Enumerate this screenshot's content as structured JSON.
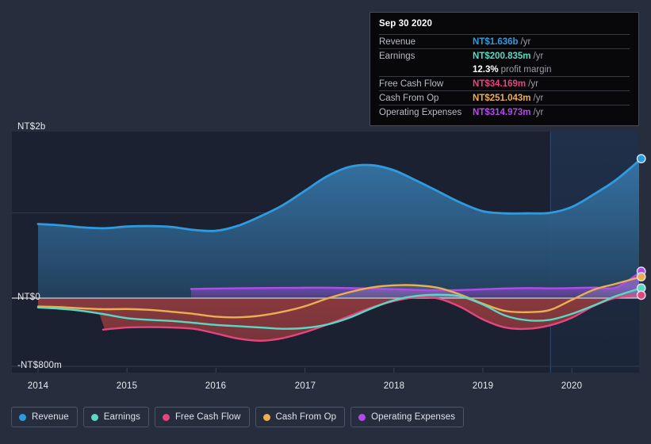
{
  "colors": {
    "background": "#262d3d",
    "plot_background": "#1b2130",
    "plot_background_future": "#1d273b",
    "revenue": "#2e9be0",
    "earnings": "#5ad8c4",
    "free_cash_flow": "#e5457e",
    "cash_from_op": "#edad52",
    "operating_expenses": "#b24be8",
    "negative_area": "#8e3a3e",
    "zero_line": "#c9ccd4",
    "grid_line": "#3b4356",
    "axis_text": "#e8eaee"
  },
  "tooltip": {
    "title": "Sep 30 2020",
    "rows": [
      {
        "name": "Revenue",
        "value": "NT$1.636b",
        "unit": "/yr",
        "color": "#2e9be0"
      },
      {
        "name": "Earnings",
        "value": "NT$200.835m",
        "unit": "/yr",
        "color": "#5ad8c4"
      },
      {
        "name": "",
        "value": "12.3%",
        "unit": "profit margin",
        "color": "#ffffff"
      },
      {
        "name": "Free Cash Flow",
        "value": "NT$34.169m",
        "unit": "/yr",
        "color": "#e5457e"
      },
      {
        "name": "Cash From Op",
        "value": "NT$251.043m",
        "unit": "/yr",
        "color": "#edad52"
      },
      {
        "name": "Operating Expenses",
        "value": "NT$314.973m",
        "unit": "/yr",
        "color": "#b24be8"
      }
    ]
  },
  "legend": {
    "items": [
      {
        "label": "Revenue",
        "color": "#2e9be0"
      },
      {
        "label": "Earnings",
        "color": "#5ad8c4"
      },
      {
        "label": "Free Cash Flow",
        "color": "#e5457e"
      },
      {
        "label": "Cash From Op",
        "color": "#edad52"
      },
      {
        "label": "Operating Expenses",
        "color": "#b24be8"
      }
    ]
  },
  "chart_data": {
    "type": "area",
    "title": "",
    "xlabel": "",
    "ylabel": "",
    "grid": true,
    "legend_position": "bottom",
    "x_ticks": [
      "2014",
      "2015",
      "2016",
      "2017",
      "2018",
      "2019",
      "2020"
    ],
    "x_tick_values": [
      2014,
      2015,
      2016,
      2017,
      2018,
      2019,
      2020
    ],
    "y_ticks": [
      "NT$2b",
      "NT$0",
      "-NT$800m"
    ],
    "y_tick_values": [
      2000,
      0,
      -800
    ],
    "ylim": [
      -1000,
      2350
    ],
    "xlim": [
      2014.0,
      2020.78
    ],
    "y_unit": "NT$ millions",
    "currency": "NT$",
    "forecast_boundary_x": 2019.76,
    "series": [
      {
        "name": "Revenue",
        "color": "#2e9be0",
        "x": [
          2014.0,
          2014.25,
          2014.5,
          2014.75,
          2015.0,
          2015.25,
          2015.5,
          2015.75,
          2016.0,
          2016.25,
          2016.5,
          2016.75,
          2017.0,
          2017.25,
          2017.5,
          2017.75,
          2018.0,
          2018.25,
          2018.5,
          2018.75,
          2019.0,
          2019.25,
          2019.5,
          2019.75,
          2020.0,
          2020.25,
          2020.5,
          2020.78
        ],
        "values": [
          870,
          855,
          830,
          820,
          840,
          845,
          835,
          800,
          790,
          850,
          960,
          1090,
          1260,
          1430,
          1540,
          1560,
          1500,
          1380,
          1250,
          1120,
          1020,
          995,
          995,
          1000,
          1070,
          1220,
          1390,
          1636
        ]
      },
      {
        "name": "Earnings",
        "color": "#5ad8c4",
        "x": [
          2014.0,
          2014.25,
          2014.5,
          2014.75,
          2015.0,
          2015.25,
          2015.5,
          2015.75,
          2016.0,
          2016.25,
          2016.5,
          2016.75,
          2017.0,
          2017.25,
          2017.5,
          2017.75,
          2018.0,
          2018.25,
          2018.5,
          2018.75,
          2019.0,
          2019.25,
          2019.5,
          2019.75,
          2020.0,
          2020.25,
          2020.5,
          2020.78
        ],
        "values": [
          -110,
          -125,
          -150,
          -190,
          -235,
          -255,
          -268,
          -290,
          -315,
          -330,
          -345,
          -360,
          -350,
          -310,
          -230,
          -120,
          -25,
          25,
          40,
          20,
          -75,
          -205,
          -260,
          -255,
          -185,
          -85,
          25,
          118
        ]
      },
      {
        "name": "Free Cash Flow",
        "color": "#e5457e",
        "x": [
          2014.73,
          2015.0,
          2015.25,
          2015.5,
          2015.75,
          2016.0,
          2016.25,
          2016.5,
          2016.75,
          2017.0,
          2017.25,
          2017.5,
          2017.75,
          2018.0,
          2018.25,
          2018.5,
          2018.75,
          2019.0,
          2019.25,
          2019.5,
          2019.75,
          2020.0,
          2020.25,
          2020.5,
          2020.78
        ],
        "values": [
          -370,
          -345,
          -340,
          -345,
          -360,
          -415,
          -475,
          -500,
          -470,
          -400,
          -310,
          -210,
          -110,
          -35,
          10,
          -5,
          -105,
          -250,
          -345,
          -360,
          -320,
          -230,
          -90,
          5,
          34
        ]
      },
      {
        "name": "Cash From Op",
        "color": "#edad52",
        "x": [
          2014.0,
          2014.25,
          2014.5,
          2014.75,
          2015.0,
          2015.25,
          2015.5,
          2015.75,
          2016.0,
          2016.25,
          2016.5,
          2016.75,
          2017.0,
          2017.25,
          2017.5,
          2017.75,
          2018.0,
          2018.25,
          2018.5,
          2018.75,
          2019.0,
          2019.25,
          2019.5,
          2019.75,
          2020.0,
          2020.25,
          2020.5,
          2020.78
        ],
        "values": [
          -98,
          -105,
          -120,
          -130,
          -128,
          -138,
          -160,
          -185,
          -218,
          -225,
          -205,
          -160,
          -95,
          -5,
          70,
          125,
          150,
          150,
          120,
          40,
          -65,
          -150,
          -165,
          -140,
          -20,
          100,
          170,
          251
        ]
      },
      {
        "name": "Operating Expenses",
        "color": "#b24be8",
        "x": [
          2015.72,
          2016.0,
          2016.25,
          2016.5,
          2016.75,
          2017.0,
          2017.25,
          2017.5,
          2017.75,
          2018.0,
          2018.25,
          2018.5,
          2018.75,
          2019.0,
          2019.25,
          2019.5,
          2019.75,
          2020.0,
          2020.25,
          2020.5,
          2020.78
        ],
        "values": [
          108,
          112,
          116,
          118,
          120,
          122,
          122,
          118,
          112,
          104,
          96,
          92,
          95,
          104,
          113,
          118,
          115,
          118,
          124,
          126,
          315
        ]
      }
    ],
    "end_markers": [
      {
        "name": "Revenue",
        "value": 1636,
        "color": "#2e9be0"
      },
      {
        "name": "Operating Expenses",
        "value": 314.97,
        "color": "#b24be8"
      },
      {
        "name": "Cash From Op",
        "value": 251.04,
        "color": "#edad52"
      },
      {
        "name": "Earnings",
        "value": 200.84,
        "color": "#5ad8c4"
      },
      {
        "name": "Free Cash Flow",
        "value": 34.17,
        "color": "#e5457e"
      }
    ]
  }
}
